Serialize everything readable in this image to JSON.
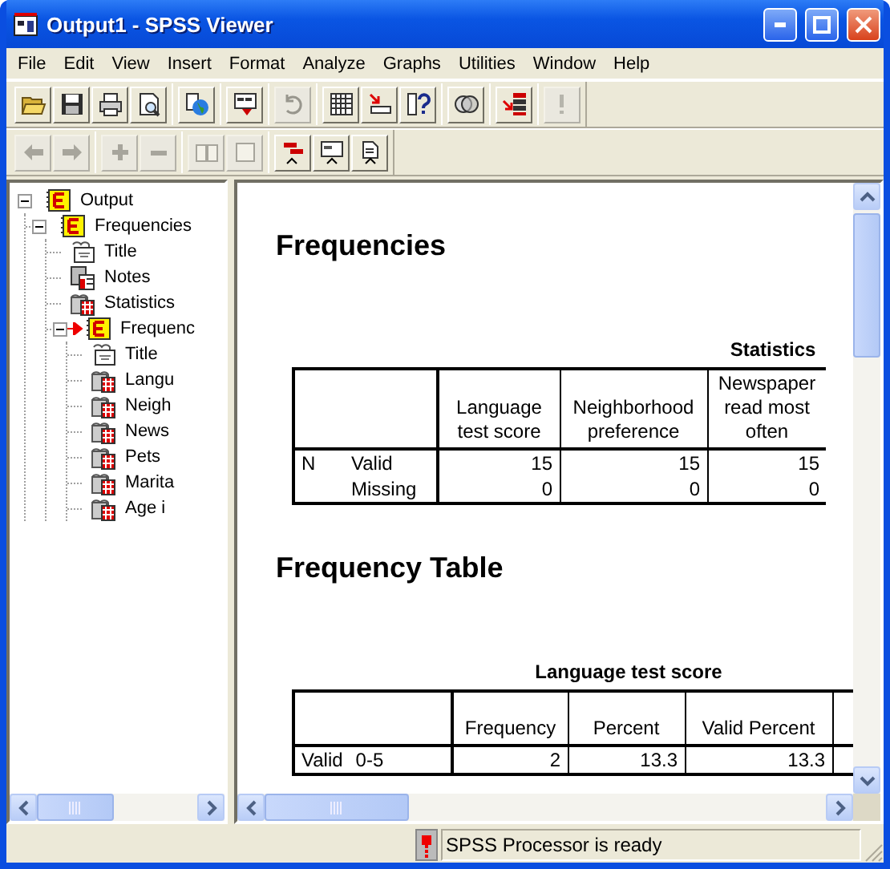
{
  "window": {
    "title": "Output1 - SPSS Viewer"
  },
  "menu": [
    "File",
    "Edit",
    "View",
    "Insert",
    "Format",
    "Analyze",
    "Graphs",
    "Utilities",
    "Window",
    "Help"
  ],
  "toolbars": [
    [
      [
        {
          "disabled": false
        },
        {
          "disabled": false
        },
        {
          "disabled": false
        },
        {
          "disabled": false
        }
      ],
      [
        {
          "disabled": false
        }
      ],
      [
        {
          "disabled": false
        }
      ],
      [
        {
          "disabled": true
        }
      ],
      [
        {
          "disabled": false
        },
        {
          "disabled": false
        },
        {
          "disabled": false
        }
      ],
      [
        {
          "disabled": false
        }
      ],
      [
        {
          "disabled": false
        }
      ],
      [
        {
          "disabled": true
        }
      ]
    ],
    [
      [
        {
          "disabled": true
        },
        {
          "disabled": true
        }
      ],
      [
        {
          "disabled": true
        },
        {
          "disabled": true
        }
      ],
      [
        {
          "disabled": true
        },
        {
          "disabled": true
        }
      ],
      [
        {
          "disabled": false
        },
        {
          "disabled": false
        },
        {
          "disabled": false
        }
      ]
    ]
  ],
  "tree": [
    {
      "label": "Output",
      "kind": "book",
      "expanded": true,
      "current": false,
      "children": [
        {
          "label": "Frequencies",
          "kind": "book",
          "expanded": true,
          "current": false,
          "children": [
            {
              "label": "Title",
              "kind": "title",
              "current": false
            },
            {
              "label": "Notes",
              "kind": "notes",
              "current": false
            },
            {
              "label": "Statistics",
              "kind": "table",
              "current": false
            },
            {
              "label": "Frequenc",
              "kind": "book",
              "expanded": true,
              "current": true,
              "children": [
                {
                  "label": "Title",
                  "kind": "title",
                  "current": false
                },
                {
                  "label": "Langu",
                  "kind": "table",
                  "current": false
                },
                {
                  "label": "Neigh",
                  "kind": "table",
                  "current": false
                },
                {
                  "label": "News",
                  "kind": "table",
                  "current": false
                },
                {
                  "label": "Pets",
                  "kind": "table",
                  "current": false
                },
                {
                  "label": "Marita",
                  "kind": "table",
                  "current": false
                },
                {
                  "label": "Age i",
                  "kind": "table",
                  "current": false
                }
              ]
            }
          ]
        }
      ]
    }
  ],
  "content": [
    {
      "kind": "heading",
      "text": "Frequencies"
    },
    {
      "kind": "table",
      "title": "Statistics",
      "columns": [
        "Language test score",
        "Neighborhood preference",
        "Newspaper read most often"
      ],
      "rows": [
        {
          "group": "N",
          "label": "Valid",
          "values": [
            "15",
            "15",
            "15"
          ]
        },
        {
          "label": "Missing",
          "values": [
            "0",
            "0",
            "0"
          ]
        }
      ]
    },
    {
      "kind": "heading",
      "text": "Frequency Table"
    },
    {
      "kind": "table",
      "title": "Language test score",
      "columns": [
        "Frequency",
        "Percent",
        "Valid Percent"
      ],
      "rows": [
        {
          "group": "Valid",
          "label": "0-5",
          "values": [
            "2",
            "13.3",
            "13.3"
          ]
        }
      ]
    }
  ],
  "status_bar": {
    "text": "SPSS Processor  is ready"
  }
}
